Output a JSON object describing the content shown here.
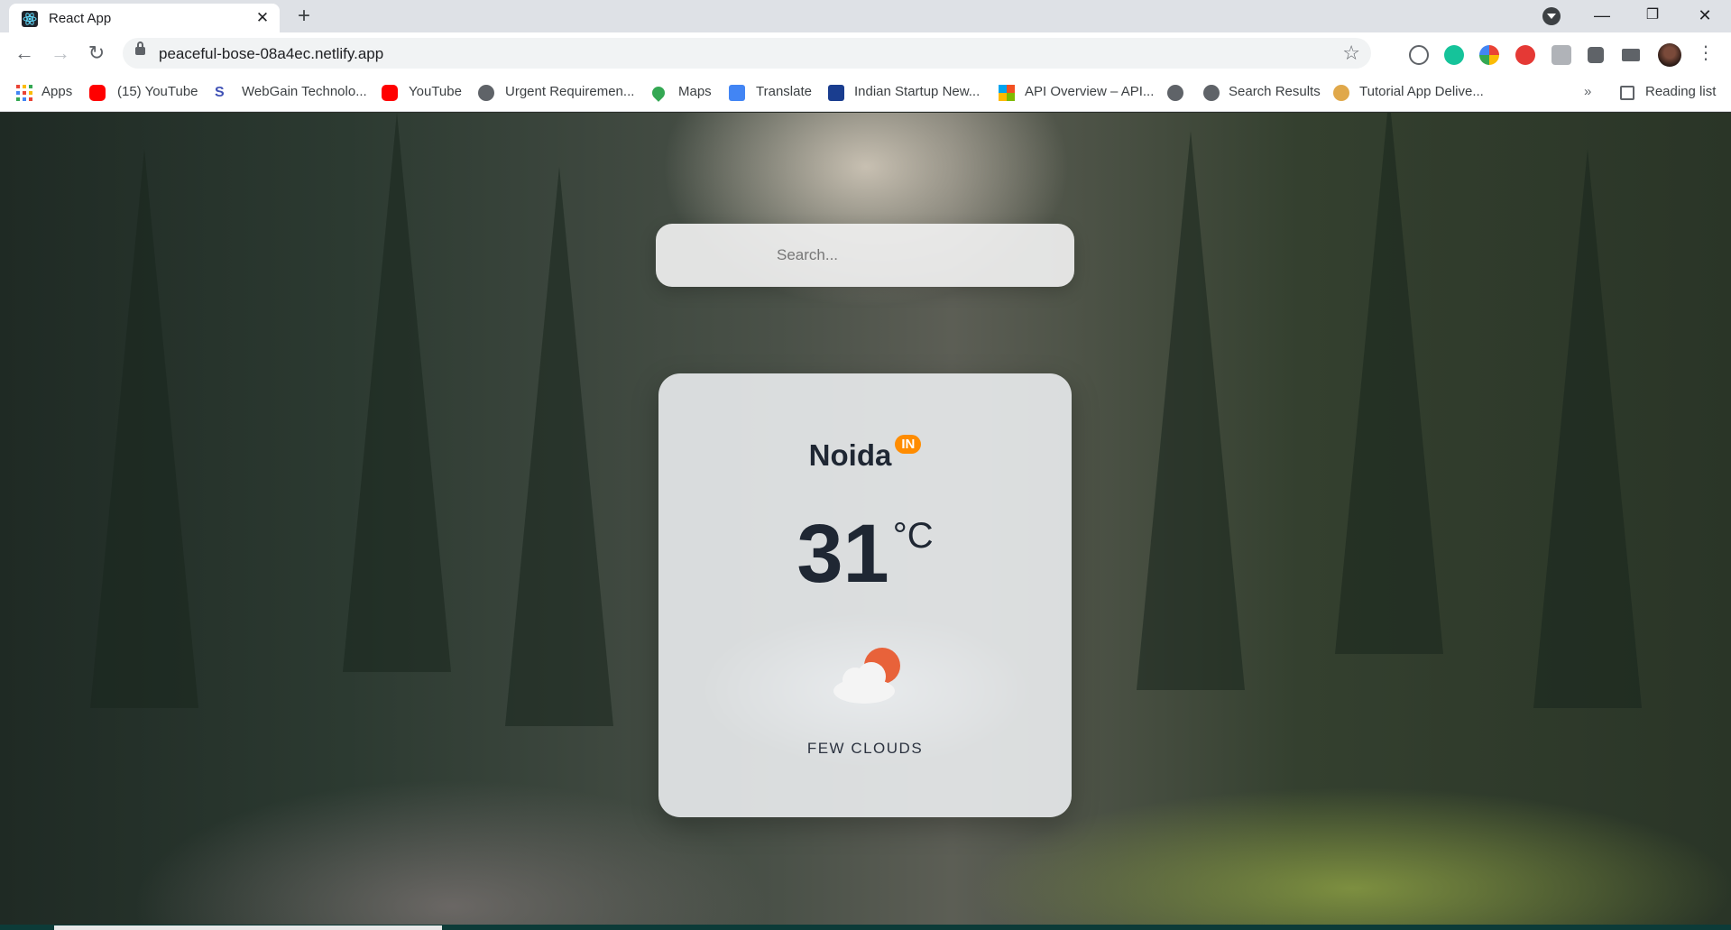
{
  "browser": {
    "tab_title": "React App",
    "tab_close": "✕",
    "new_tab": "+",
    "url": "peaceful-bose-08a4ec.netlify.app",
    "reading_list": "Reading list",
    "overflow": "»",
    "bookmarks": [
      {
        "label": "Apps",
        "icon": "apps-grid-icon"
      },
      {
        "label": "(15) YouTube",
        "icon": "youtube-icon"
      },
      {
        "label": "WebGain Technolo...",
        "icon": "webgain-icon"
      },
      {
        "label": "YouTube",
        "icon": "youtube-icon"
      },
      {
        "label": "Urgent Requiremen...",
        "icon": "globe-icon"
      },
      {
        "label": "Maps",
        "icon": "maps-pin-icon"
      },
      {
        "label": "Translate",
        "icon": "translate-icon"
      },
      {
        "label": "Indian Startup New...",
        "icon": "isn-icon"
      },
      {
        "label": "API Overview – API...",
        "icon": "microsoft-icon"
      },
      {
        "label": "Search Results",
        "icon": "globe-icon"
      },
      {
        "label": "Tutorial App Delive...",
        "icon": "avatar-icon"
      }
    ]
  },
  "app": {
    "search_placeholder": "Search...",
    "city": "Noida",
    "country": "IN",
    "temperature": "31",
    "unit": "°C",
    "description": "FEW CLOUDS",
    "weather_icon": "few-clouds-icon"
  },
  "colors": {
    "badge": "#ff8c00",
    "sun": "#e8623a",
    "text_dark": "#1f2733"
  }
}
